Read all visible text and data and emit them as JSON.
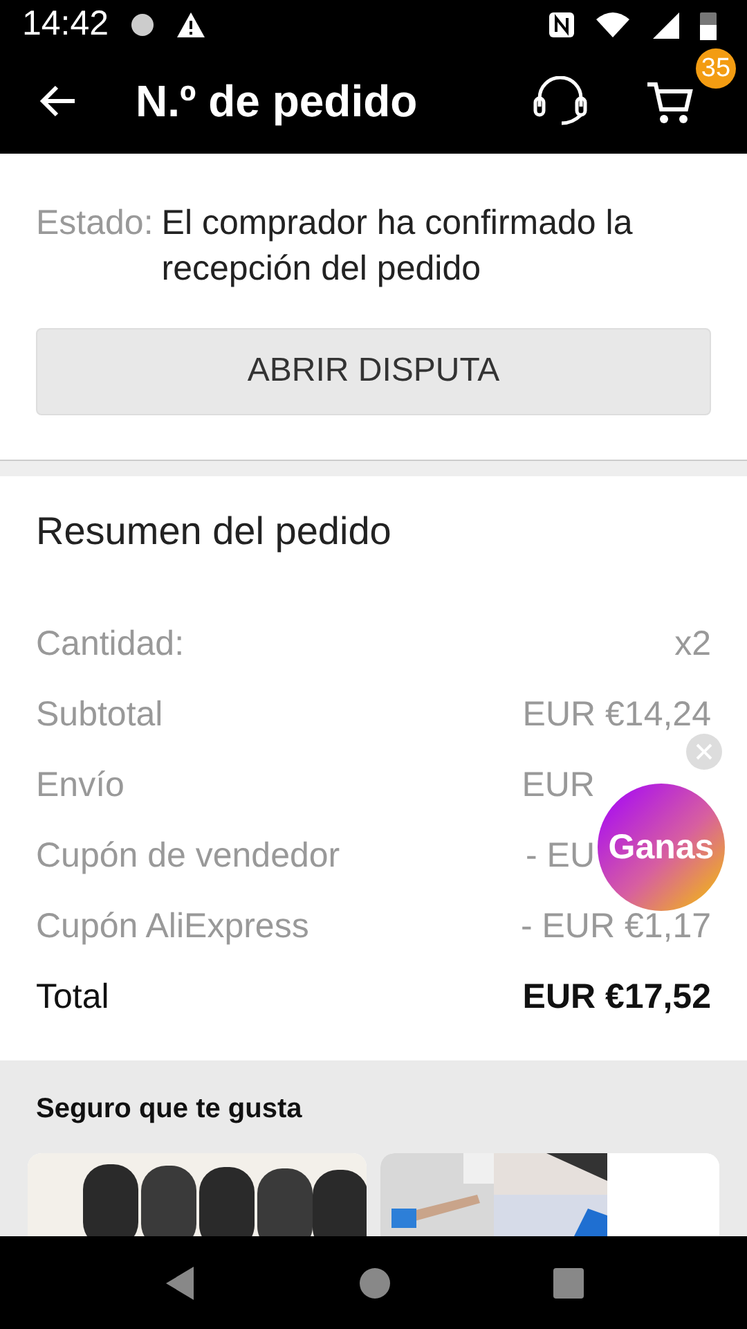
{
  "status_bar": {
    "time": "14:42"
  },
  "header": {
    "title": "N.º de pedido",
    "cart_count": "35"
  },
  "order": {
    "status_label": "Estado:",
    "status_text": "El comprador ha confirmado la recepción del pedido",
    "dispute_button": "ABRIR DISPUTA"
  },
  "summary": {
    "title": "Resumen del pedido",
    "rows": [
      {
        "label": "Cantidad:",
        "value": "x2"
      },
      {
        "label": "Subtotal",
        "value": "EUR €14,24"
      },
      {
        "label": "Envío",
        "value": "EUR"
      },
      {
        "label": "Cupón de vendedor",
        "value": "- EU"
      },
      {
        "label": "Cupón AliExpress",
        "value": "- EUR €1,17"
      }
    ],
    "total_label": "Total",
    "total_value": "EUR €17,52"
  },
  "promo_bubble": {
    "label": "Ganas"
  },
  "recommendations": {
    "title": "Seguro que te gusta"
  }
}
